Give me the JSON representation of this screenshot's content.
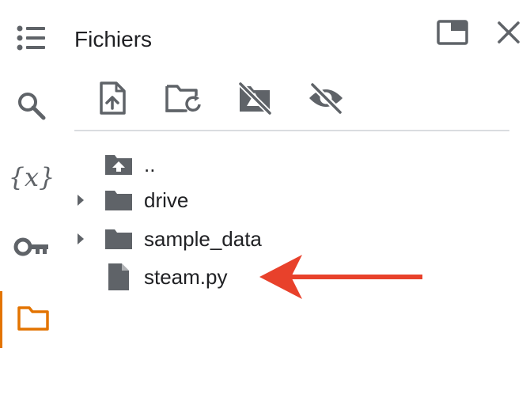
{
  "sidebar": {
    "items": [
      {
        "icon": "table-of-contents-icon",
        "active": false
      },
      {
        "icon": "search-icon",
        "active": false
      },
      {
        "icon": "variables-icon",
        "label": "{x}",
        "active": false
      },
      {
        "icon": "key-icon",
        "active": false
      },
      {
        "icon": "folder-icon",
        "active": true
      }
    ],
    "active_color": "#e37400"
  },
  "panel": {
    "title": "Fichiers"
  },
  "toolbar": {
    "buttons": [
      {
        "icon": "upload-file-icon"
      },
      {
        "icon": "refresh-folder-icon"
      },
      {
        "icon": "drive-off-icon"
      },
      {
        "icon": "hide-icon"
      }
    ]
  },
  "tree": {
    "items": [
      {
        "name": "..",
        "type": "parent",
        "icon": "folder-up-icon",
        "expandable": false
      },
      {
        "name": "drive",
        "type": "folder",
        "icon": "folder-icon",
        "expandable": true
      },
      {
        "name": "sample_data",
        "type": "folder",
        "icon": "folder-icon",
        "expandable": true
      },
      {
        "name": "steam.py",
        "type": "file",
        "icon": "file-icon",
        "expandable": false
      }
    ]
  },
  "annotation": {
    "arrow_color": "#e8412b",
    "points_to": "steam.py"
  },
  "colors": {
    "icon_gray": "#5f6368",
    "divider": "#dadce0",
    "text": "#202124"
  }
}
